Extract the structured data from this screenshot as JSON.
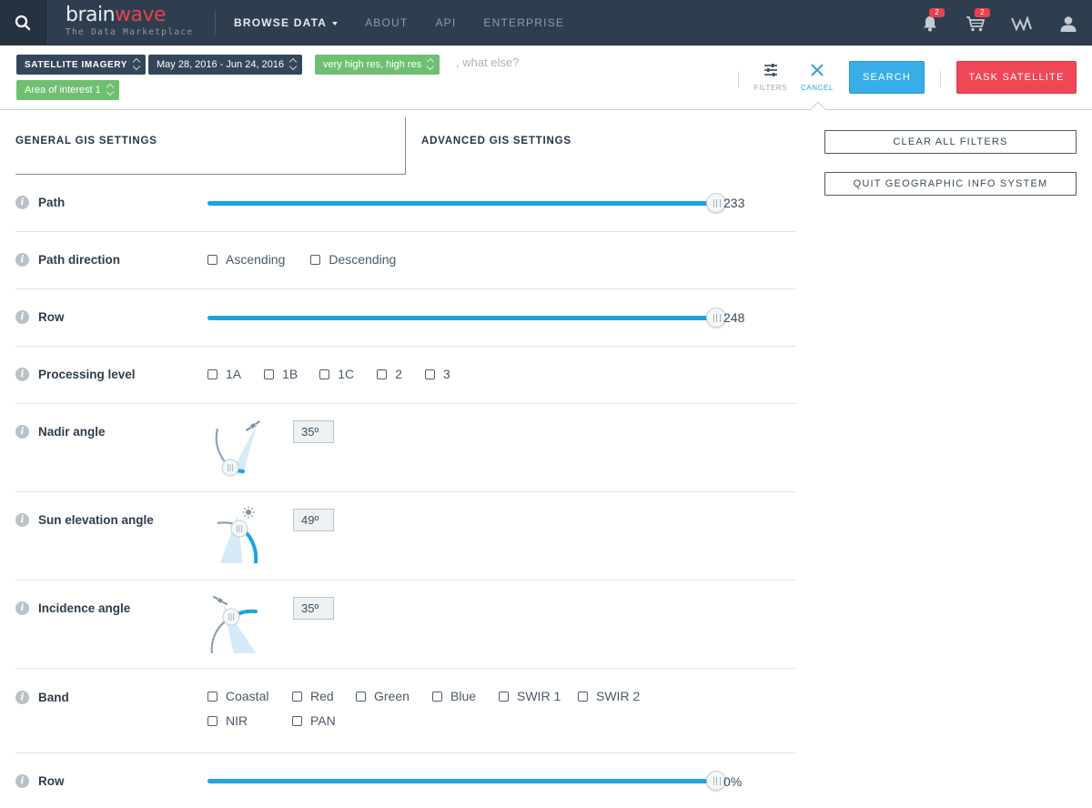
{
  "brand": {
    "name_part1": "brain",
    "name_part2": "wave",
    "tagline": "The Data Marketplace"
  },
  "nav": {
    "links": [
      {
        "label": "BROWSE DATA",
        "active": true
      },
      {
        "label": "ABOUT"
      },
      {
        "label": "API"
      },
      {
        "label": "ENTERPRISE"
      }
    ],
    "notifications_count": "2",
    "cart_count": "2",
    "icons": [
      "search-icon",
      "bell-icon",
      "cart-icon",
      "marketplace-icon",
      "user-icon"
    ]
  },
  "filters": {
    "chips": [
      {
        "label": "SATELLITE IMAGERY"
      },
      {
        "label": "May 28, 2016 - Jun 24, 2016"
      },
      {
        "label": "very high res, high res"
      },
      {
        "label": "Area of interest 1"
      }
    ],
    "placeholder": ", what else?",
    "filters_label": "FILTERS",
    "cancel_label": "CANCEL",
    "search_label": "SEARCH",
    "task_label": "TASK SATELLITE"
  },
  "tabs": {
    "general": "GENERAL GIS SETTINGS",
    "advanced": "ADVANCED GIS SETTINGS"
  },
  "actions": {
    "clear_all": "CLEAR ALL FILTERS",
    "quit_gis": "QUIT GEOGRAPHIC INFO SYSTEM"
  },
  "settings": {
    "path": {
      "label": "Path",
      "value": "233",
      "fill_fraction": 1.0
    },
    "path_direction": {
      "label": "Path direction",
      "options": [
        "Ascending",
        "Descending"
      ]
    },
    "row": {
      "label": "Row",
      "value": "248",
      "fill_fraction": 1.0
    },
    "processing_level": {
      "label": "Processing level",
      "options": [
        "1A",
        "1B",
        "1C",
        "2",
        "3"
      ]
    },
    "nadir_angle": {
      "label": "Nadir angle",
      "value": "35º"
    },
    "sun_elevation": {
      "label": "Sun elevation angle",
      "value": "49º"
    },
    "incidence_angle": {
      "label": "Incidence angle",
      "value": "35º"
    },
    "band": {
      "label": "Band",
      "options_line1": [
        "Coastal",
        "Red",
        "Green",
        "Blue",
        "SWIR 1",
        "SWIR 2"
      ],
      "options_line2": [
        "NIR",
        "PAN"
      ]
    },
    "row_bottom": {
      "label": "Row",
      "value": "0%",
      "fill_fraction": 1.0
    }
  },
  "colors": {
    "navbar": "#2f3e4e",
    "accent_blue": "#1fa3e3",
    "brand_red": "#e8414d",
    "chip_dark": "#34475a",
    "chip_green": "#6fbf73"
  }
}
